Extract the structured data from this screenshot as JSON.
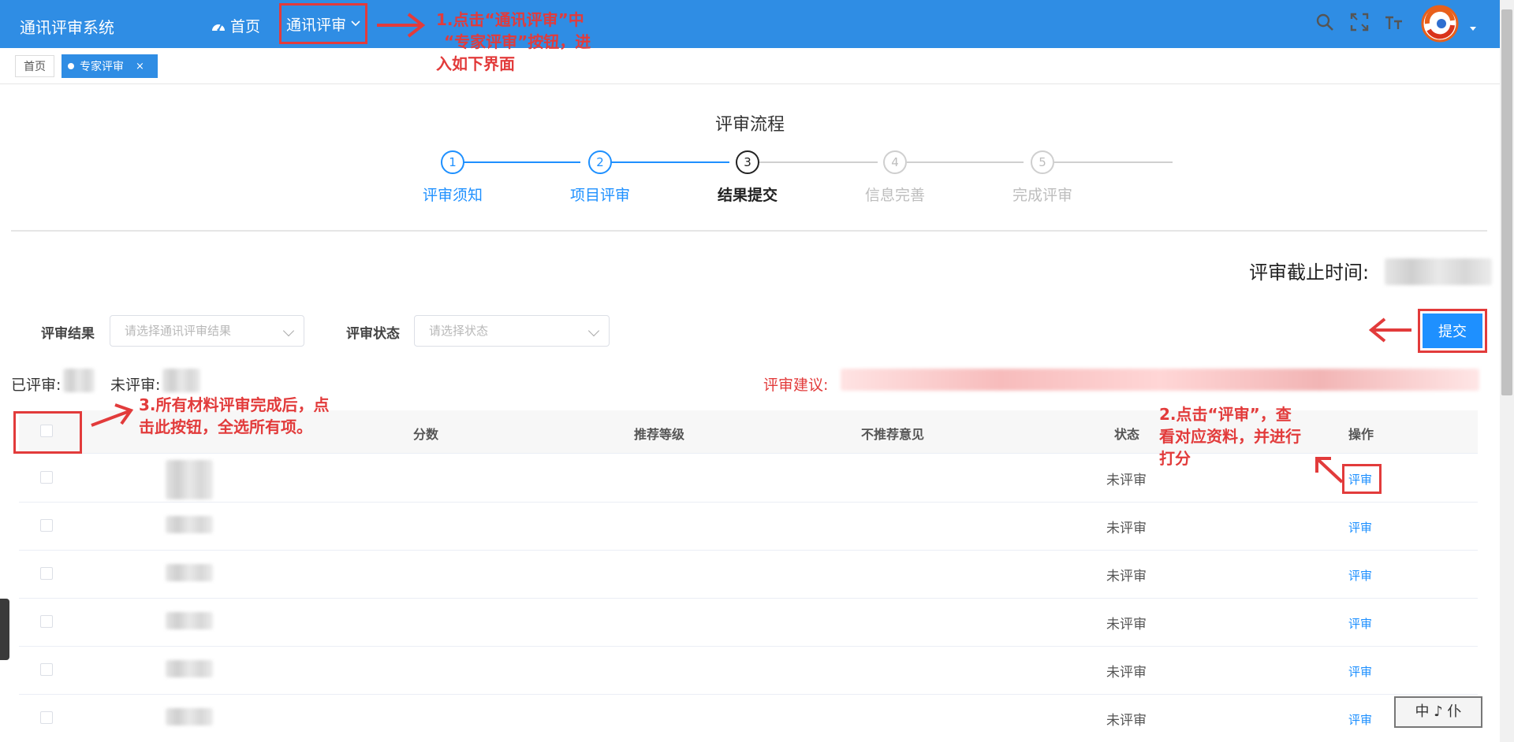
{
  "header": {
    "brand": "通讯评审系统",
    "nav_home": "首页",
    "nav_review": "通讯评审",
    "icons": [
      "search-icon",
      "fullscreen-icon",
      "font-size-icon"
    ]
  },
  "tabs": {
    "home": "首页",
    "active": "专家评审",
    "close": "×"
  },
  "steps": {
    "title": "评审流程",
    "items": [
      {
        "num": "1",
        "label": "评审须知",
        "state": "done"
      },
      {
        "num": "2",
        "label": "项目评审",
        "state": "done"
      },
      {
        "num": "3",
        "label": "结果提交",
        "state": "current"
      },
      {
        "num": "4",
        "label": "信息完善",
        "state": "pending"
      },
      {
        "num": "5",
        "label": "完成评审",
        "state": "pending"
      }
    ]
  },
  "deadline_label": "评审截止时间:",
  "filters": {
    "result_label": "评审结果",
    "result_placeholder": "请选择通讯评审结果",
    "status_label": "评审状态",
    "status_placeholder": "请选择状态"
  },
  "submit_label": "提交",
  "stats": {
    "reviewed_label": "已评审:",
    "unreviewed_label": "未评审:",
    "suggestion_label": "评审建议:"
  },
  "table": {
    "headers": {
      "score": "分数",
      "grade": "推荐等级",
      "opinion": "不推荐意见",
      "status": "状态",
      "action": "操作"
    },
    "rows": [
      {
        "status": "未评审",
        "action": "评审"
      },
      {
        "status": "未评审",
        "action": "评审"
      },
      {
        "status": "未评审",
        "action": "评审"
      },
      {
        "status": "未评审",
        "action": "评审"
      },
      {
        "status": "未评审",
        "action": "评审"
      },
      {
        "status": "未评审",
        "action": "评审"
      }
    ]
  },
  "annotations": {
    "a1_line1": "1.点击“通讯评审”中",
    "a1_line2": "“专家评审”按钮，进",
    "a1_line3": "入如下界面",
    "a2_line1": "2.点击“评审”，查",
    "a2_line2": "看对应资料，并进行",
    "a2_line3": "打分",
    "a3_line1": "3.所有材料评审完成后，点",
    "a3_line2": "击此按钮，全选所有项。"
  },
  "stamp_text": "中 ♪ 仆",
  "colors": {
    "primary": "#2f8de4",
    "annotation": "#e23b3b",
    "link": "#1e90ff"
  }
}
